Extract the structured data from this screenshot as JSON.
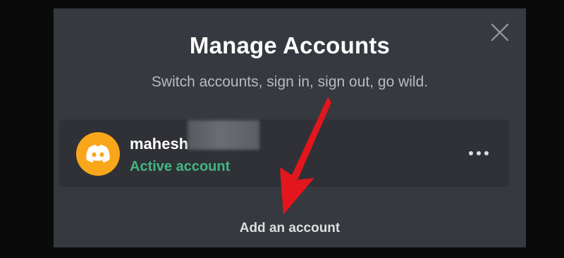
{
  "modal": {
    "title": "Manage Accounts",
    "subtitle": "Switch accounts, sign in, sign out, go wild.",
    "close_icon": "close-icon"
  },
  "account": {
    "username": "mahesh",
    "status": "Active account",
    "avatar_icon": "discord-logo-icon",
    "avatar_color": "#faa61a",
    "status_color": "#43b581",
    "more_icon": "more-horizontal-icon"
  },
  "footer": {
    "add_account_label": "Add an account"
  },
  "annotation": {
    "arrow_color": "#e3161d",
    "arrow_icon": "red-arrow-annotation"
  }
}
